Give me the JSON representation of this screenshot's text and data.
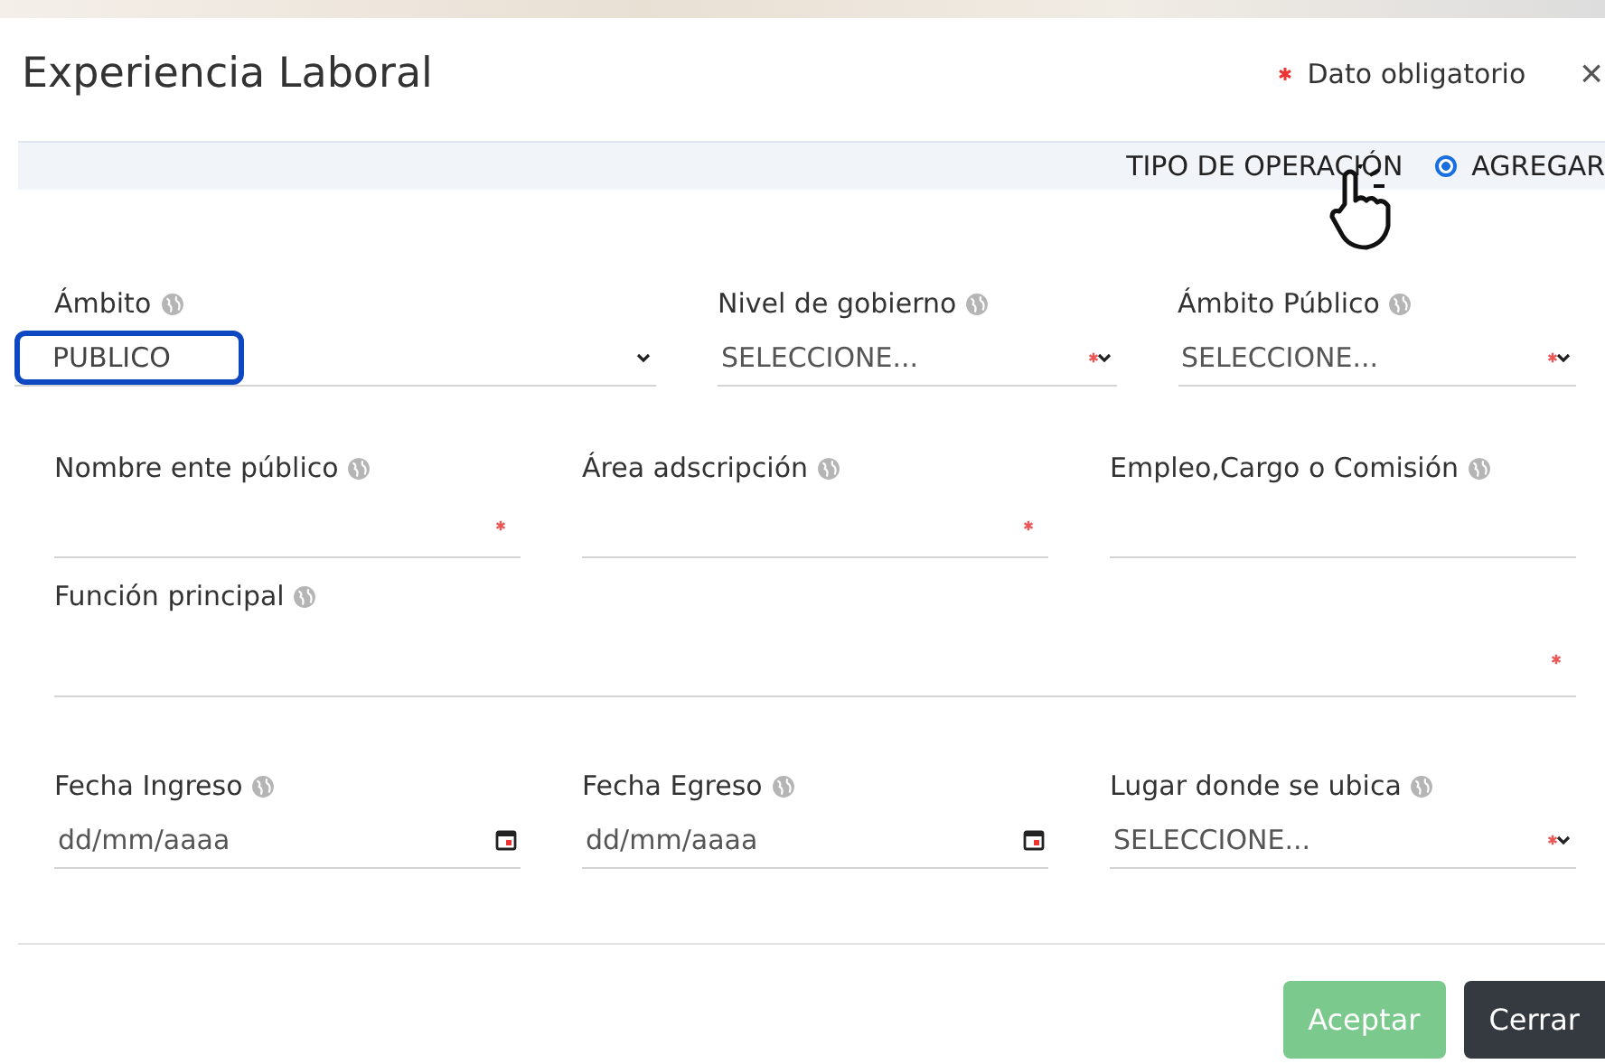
{
  "dialog": {
    "title": "Experiencia Laboral",
    "required_note": "Dato obligatorio",
    "close": "×"
  },
  "operation": {
    "label": "TIPO DE OPERACIÓN",
    "option": "AGREGAR",
    "selected": true
  },
  "rows": [
    {
      "fields": [
        {
          "label": "Ámbito",
          "kind": "select",
          "value": "PUBLICO",
          "required": false,
          "highlighted": true
        },
        {
          "label": "Nivel de gobierno",
          "kind": "select",
          "placeholder": "SELECCIONE...",
          "required": true
        },
        {
          "label": "Ámbito Público",
          "kind": "select",
          "placeholder": "SELECCIONE...",
          "required": true
        }
      ]
    },
    {
      "fields": [
        {
          "label": "Nombre ente público",
          "kind": "text",
          "required": true
        },
        {
          "label": "Área adscripción",
          "kind": "text",
          "required": true
        },
        {
          "label": "Empleo,Cargo o Comisión",
          "kind": "text",
          "required": false
        }
      ]
    },
    {
      "fields": [
        {
          "label": "Función principal",
          "kind": "text",
          "required": true
        }
      ]
    },
    {
      "fields": [
        {
          "label": "Fecha Ingreso",
          "kind": "date",
          "placeholder": "dd/mm/aaaa",
          "required": false
        },
        {
          "label": "Fecha Egreso",
          "kind": "date",
          "placeholder": "dd/mm/aaaa",
          "required": false
        },
        {
          "label": "Lugar donde se ubica",
          "kind": "select",
          "placeholder": "SELECCIONE...",
          "required": true
        }
      ]
    }
  ],
  "buttons": [
    {
      "label": "Aceptar",
      "kind": "primary",
      "disabled": true
    },
    {
      "label": "Cerrar",
      "kind": "secondary",
      "disabled": false
    }
  ]
}
